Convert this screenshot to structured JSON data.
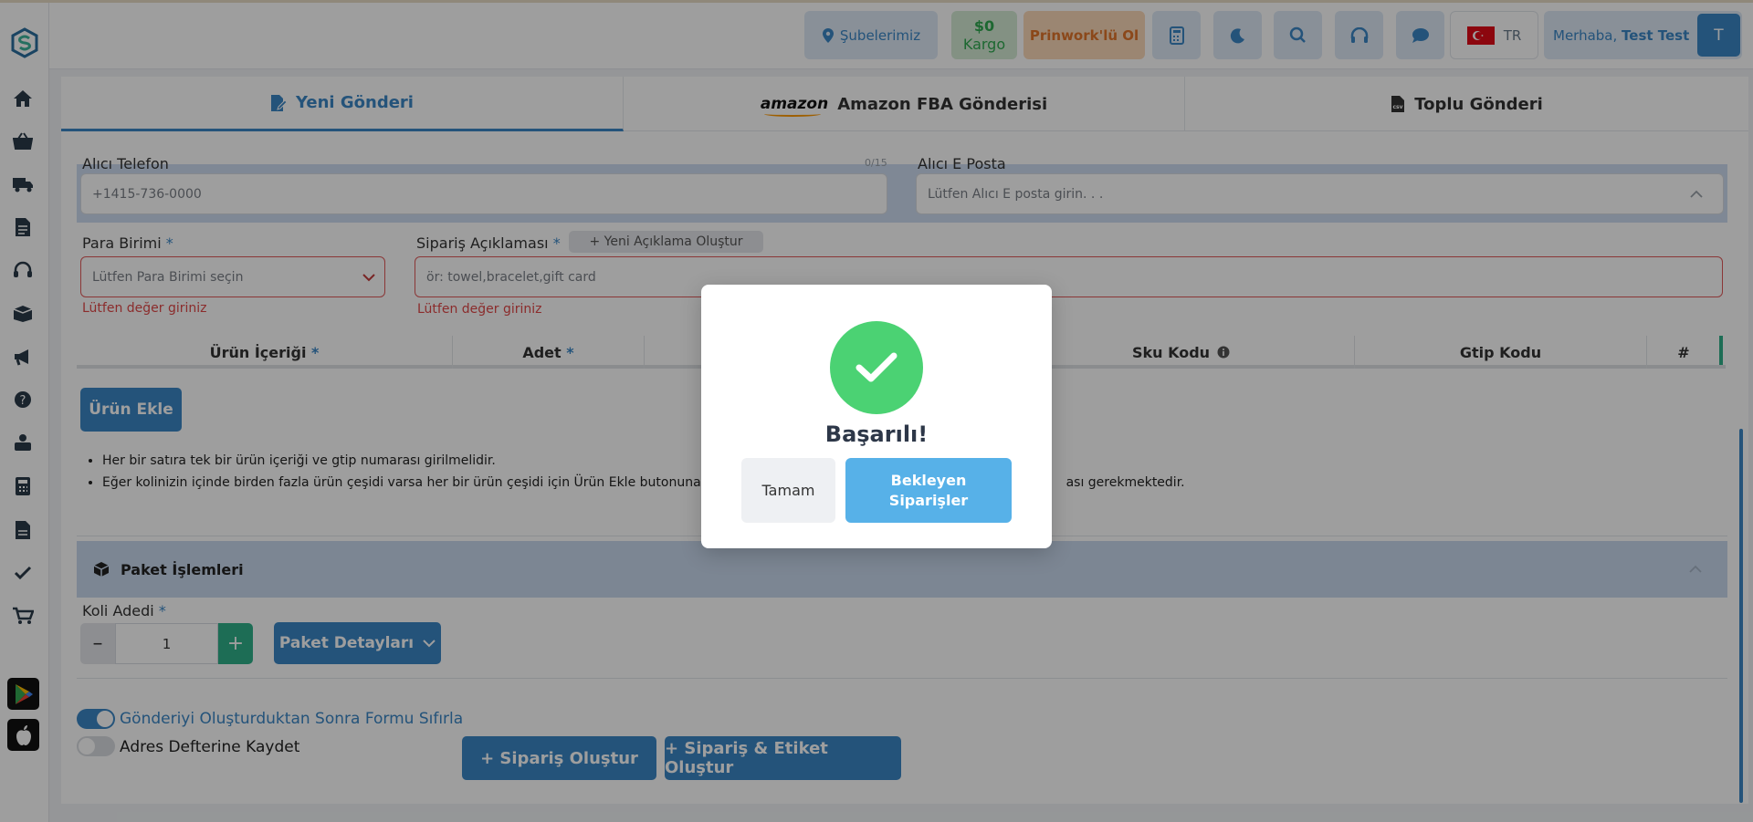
{
  "header": {
    "branches_label": "Şubelerimiz",
    "cargo_balance": "$0",
    "cargo_label": "Kargo",
    "prinwork_label": "Prinwork'lü Ol",
    "language": "TR",
    "greeting": "Merhaba, ",
    "user_name": "Test Test",
    "avatar_initial": "T"
  },
  "tabs": [
    {
      "label": "Yeni Gönderi",
      "active": true
    },
    {
      "logo": "amazon",
      "label": "Amazon FBA Gönderisi"
    },
    {
      "label": "Toplu Gönderi"
    }
  ],
  "form": {
    "phone_label": "Alıcı Telefon",
    "phone_placeholder": "+1415-736-0000",
    "phone_counter": "0/15",
    "email_label": "Alıcı E Posta",
    "email_placeholder": "Lütfen Alıcı E posta girin. . .",
    "currency_label": "Para Birimi",
    "currency_placeholder": "Lütfen Para Birimi seçin",
    "currency_error": "Lütfen değer giriniz",
    "order_desc_label": "Sipariş Açıklaması",
    "new_desc_button": "+ Yeni Açıklama Oluştur",
    "order_desc_placeholder": "ör: towel,bracelet,gift card",
    "order_desc_error": "Lütfen değer giriniz",
    "required_mark": "*"
  },
  "product_table": {
    "columns": [
      "Ürün İçeriği",
      "Adet",
      "Sku Kodu",
      "Gtip Kodu",
      "#"
    ],
    "add_product_button": "Ürün Ekle",
    "notes": [
      "Her bir satıra tek bir ürün içeriği ve gtip numarası girilmelidir.",
      "Eğer kolinizin içinde birden fazla ürün çeşidi varsa her bir ürün çeşidi için Ürün Ekle butonuna tık",
      "ası gerekmektedir."
    ]
  },
  "package": {
    "section_title": "Paket İşlemleri",
    "box_count_label": "Koli Adedi",
    "box_count_value": "1",
    "minus": "–",
    "plus": "+",
    "details_button": "Paket Detayları"
  },
  "footer": {
    "reset_toggle_label": "Gönderiyi Oluşturduktan Sonra Formu Sıfırla",
    "reset_toggle_on": true,
    "address_toggle_label": "Adres Defterine Kaydet",
    "address_toggle_on": false,
    "create_order_button": "+ Sipariş Oluştur",
    "create_order_label_button": "+ Sipariş & Etiket Oluştur"
  },
  "modal": {
    "title": "Başarılı!",
    "ok_button": "Tamam",
    "pending_button": "Bekleyen Siparişler"
  },
  "colors": {
    "primary": "#3a86c6",
    "success": "#4bd273",
    "error": "#e04848",
    "cargo_text": "#2fa84f",
    "prinwork_text": "#e0742a"
  }
}
